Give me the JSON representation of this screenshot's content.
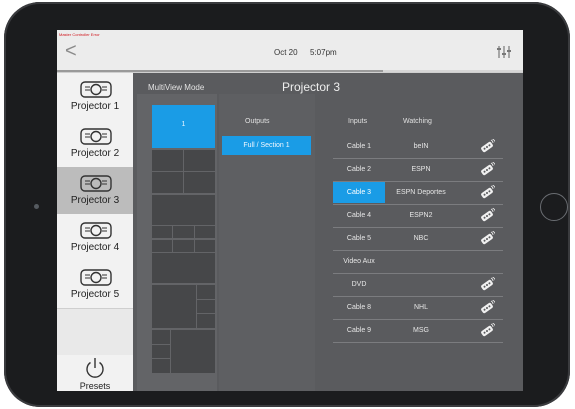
{
  "header": {
    "error_text": "Master Controller Error",
    "back_glyph": "<",
    "date": "Oct 20",
    "time": "5:07pm",
    "settings_icon": "mixer-sliders-icon",
    "load_progress": 0.7
  },
  "sidebar": {
    "projectors": [
      {
        "label": "Projector 1",
        "active": false
      },
      {
        "label": "Projector 2",
        "active": false
      },
      {
        "label": "Projector 3",
        "active": true
      },
      {
        "label": "Projector 4",
        "active": false
      },
      {
        "label": "Projector 5",
        "active": false
      }
    ],
    "presets_label": "Presets"
  },
  "multiview": {
    "title": "MultiView Mode",
    "selected_label": "1"
  },
  "main": {
    "title": "Projector 3"
  },
  "outputs": {
    "header": "Outputs",
    "items": [
      "Full / Section 1"
    ]
  },
  "inputs": {
    "header_inputs": "Inputs",
    "header_watching": "Watching",
    "rows": [
      {
        "input": "Cable 1",
        "watching": "beIN",
        "remote": true,
        "selected": false
      },
      {
        "input": "Cable 2",
        "watching": "ESPN",
        "remote": true,
        "selected": false
      },
      {
        "input": "Cable 3",
        "watching": "ESPN Deportes",
        "remote": true,
        "selected": true
      },
      {
        "input": "Cable 4",
        "watching": "ESPN2",
        "remote": true,
        "selected": false
      },
      {
        "input": "Cable 5",
        "watching": "NBC",
        "remote": true,
        "selected": false
      },
      {
        "input": "Video Aux",
        "watching": "",
        "remote": false,
        "selected": false
      },
      {
        "input": "DVD",
        "watching": "",
        "remote": true,
        "selected": false
      },
      {
        "input": "Cable 8",
        "watching": "NHL",
        "remote": true,
        "selected": false
      },
      {
        "input": "Cable 9",
        "watching": "MSG",
        "remote": true,
        "selected": false
      }
    ]
  },
  "colors": {
    "accent": "#1a9ce6",
    "panel": "#5a5b5e",
    "error": "#d0141b"
  }
}
